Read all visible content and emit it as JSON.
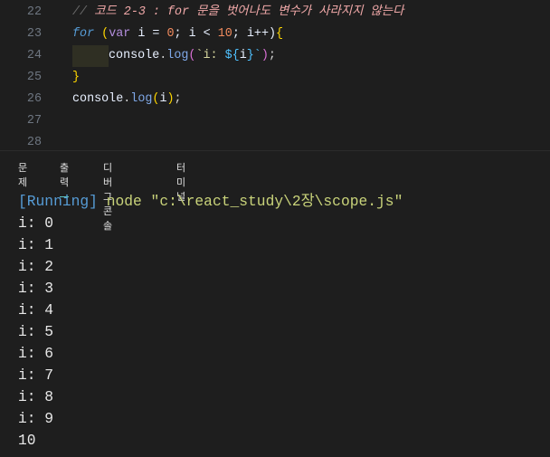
{
  "editor": {
    "lines": [
      {
        "n": "22",
        "comment_slash": "// ",
        "comment": "코드 2-3 : for 문을 벗어나도 변수가 사라지지 않는다"
      },
      {
        "n": "23",
        "t": [
          "for",
          " (",
          "var",
          " i = ",
          "0",
          "; i < ",
          "10",
          "; i++)",
          "{"
        ]
      },
      {
        "n": "24",
        "t": [
          "console",
          ".",
          "log",
          "(",
          "`i: ",
          "${",
          "i",
          "}`",
          ")",
          ";"
        ]
      },
      {
        "n": "25",
        "t": [
          "}"
        ]
      },
      {
        "n": "26",
        "t": [
          "console",
          ".",
          "log",
          "(",
          "i",
          ")",
          ";"
        ]
      },
      {
        "n": "27"
      },
      {
        "n": "28"
      }
    ]
  },
  "panel": {
    "tabs": [
      {
        "label": "문제"
      },
      {
        "label": "출력",
        "active": true
      },
      {
        "label": "디버그 콘솔"
      },
      {
        "label": "터미널"
      }
    ],
    "output": {
      "running": "[Running]",
      "command": " node \"c:\\react_study\\2장\\scope.js\"",
      "lines": [
        "i: 0",
        "i: 1",
        "i: 2",
        "i: 3",
        "i: 4",
        "i: 5",
        "i: 6",
        "i: 7",
        "i: 8",
        "i: 9",
        "10"
      ]
    }
  }
}
